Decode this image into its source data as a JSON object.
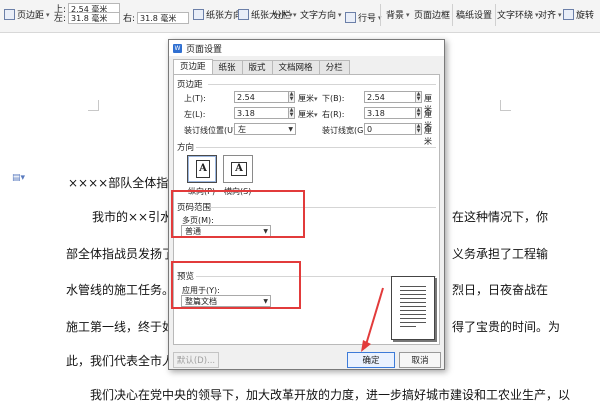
{
  "ribbon": {
    "page_margin_label": "页边距",
    "top_label": "上:",
    "top_value": "2.54 毫米",
    "left_label": "左:",
    "left_value": "31.8 毫米",
    "right_label": "右:",
    "right_value": "31.8 毫米",
    "orientation_label": "纸张方向",
    "size_label": "纸张大小",
    "columns_label": "分栏",
    "text_direction_label": "文字方向",
    "line_numbers_label": "行号",
    "background_label": "背景",
    "page_border_label": "页面边框",
    "paper_settings_label": "稿纸设置",
    "text_wrap_label": "文字环绕",
    "align_label": "对齐",
    "rotate_label": "旋转"
  },
  "document": {
    "title_line": "××××部队全体指战",
    "para1_line1_left": "我市的××引水工",
    "para1_line1_right": "在这种情况下，你",
    "para1_line2_left": "部全体指战员发扬了",
    "para1_line2_right": "义务承担了工程输",
    "para1_line3_left": "水管线的施工任务。",
    "para1_line3_right": "烈日，日夜奋战在",
    "para1_line4_left": "施工第一线，终于如",
    "para1_line4_right": "得了宝贵的时间。为",
    "para1_line5_left": "此，我们代表全市人",
    "para2_line1": "我们决心在党中央的领导下，加大改革开放的力度，进一步搞好城市建设和工农业生产，以"
  },
  "dialog": {
    "title": "页面设置",
    "tabs": [
      "页边距",
      "纸张",
      "版式",
      "文档网格",
      "分栏"
    ],
    "margins_section": "页边距",
    "top_label": "上(T):",
    "top_value": "2.54",
    "bottom_label": "下(B):",
    "bottom_value": "2.54",
    "left_label": "左(L):",
    "left_value": "3.18",
    "right_label": "右(R):",
    "right_value": "3.18",
    "unit": "厘米",
    "gutter_pos_label": "装订线位置(U):",
    "gutter_pos_value": "左",
    "gutter_width_label": "装订线宽(G):",
    "gutter_width_value": "0",
    "orientation_section": "方向",
    "portrait_label": "纵向(P)",
    "landscape_label": "横向(S)",
    "page_range_section": "页码范围",
    "multiple_pages_label": "多页(M):",
    "multiple_pages_value": "普通",
    "preview_section": "预览",
    "apply_to_label": "应用于(Y):",
    "apply_to_value": "整篇文档",
    "default_button": "默认(D)...",
    "ok_button": "确定",
    "cancel_button": "取消"
  },
  "colors": {
    "annotation_red": "#e23b3b",
    "primary_button_border": "#3d7bd8"
  }
}
